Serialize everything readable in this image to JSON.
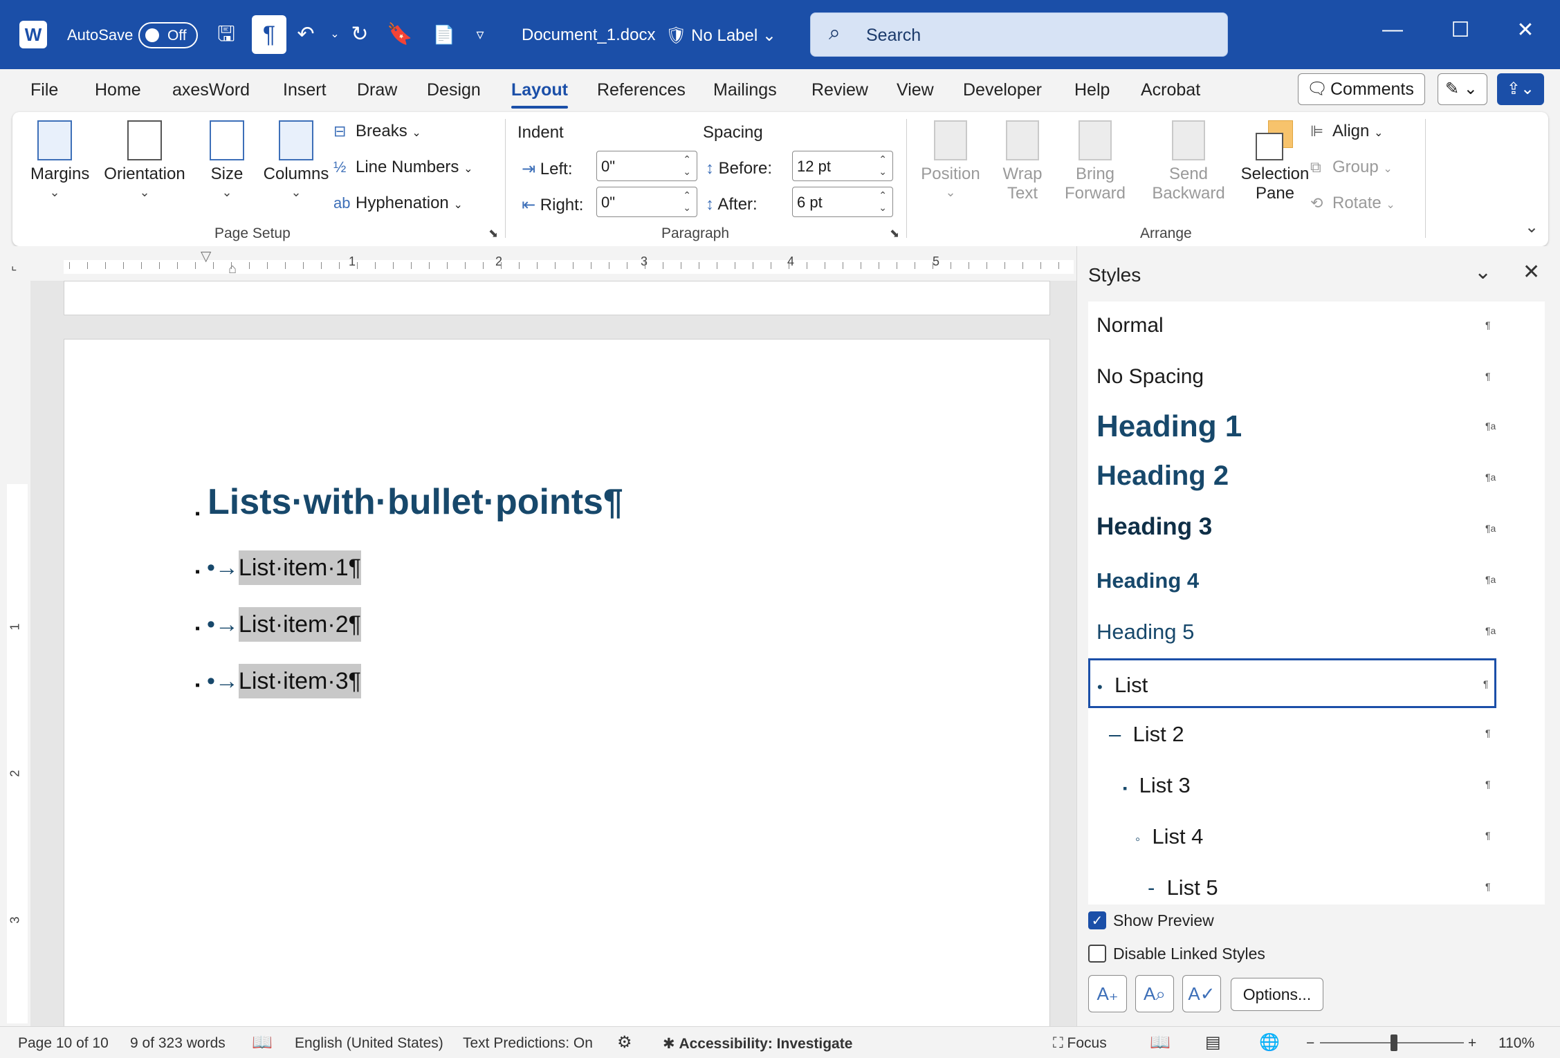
{
  "titlebar": {
    "app_logo": "W",
    "autosave_label": "AutoSave",
    "autosave_state": "Off",
    "pilcrow": "¶",
    "document_title": "Document_1.docx",
    "label_text": "No Label",
    "search_placeholder": "Search"
  },
  "tabs": [
    {
      "label": "File"
    },
    {
      "label": "Home"
    },
    {
      "label": "axesWord"
    },
    {
      "label": "Insert"
    },
    {
      "label": "Draw"
    },
    {
      "label": "Design"
    },
    {
      "label": "Layout"
    },
    {
      "label": "References"
    },
    {
      "label": "Mailings"
    },
    {
      "label": "Review"
    },
    {
      "label": "View"
    },
    {
      "label": "Developer"
    },
    {
      "label": "Help"
    },
    {
      "label": "Acrobat"
    }
  ],
  "active_tab": "Layout",
  "comments_label": "Comments",
  "ribbon": {
    "page_setup": {
      "margins": "Margins",
      "orientation": "Orientation",
      "size": "Size",
      "columns": "Columns",
      "breaks": "Breaks",
      "line_numbers": "Line Numbers",
      "hyphenation": "Hyphenation",
      "group_label": "Page Setup"
    },
    "paragraph": {
      "indent_heading": "Indent",
      "spacing_heading": "Spacing",
      "left_label": "Left:",
      "left_value": "0\"",
      "right_label": "Right:",
      "right_value": "0\"",
      "before_label": "Before:",
      "before_value": "12 pt",
      "after_label": "After:",
      "after_value": "6 pt",
      "group_label": "Paragraph"
    },
    "arrange": {
      "position_1": "Position",
      "wrap_1": "Wrap",
      "wrap_2": "Text",
      "bring_1": "Bring",
      "bring_2": "Forward",
      "send_1": "Send",
      "send_2": "Backward",
      "selection_1": "Selection",
      "selection_2": "Pane",
      "align": "Align",
      "group": "Group",
      "rotate": "Rotate",
      "group_label": "Arrange"
    }
  },
  "ruler": {
    "numbers": [
      "1",
      "2",
      "3",
      "4",
      "5"
    ],
    "vertical_numbers": [
      "1",
      "2",
      "3"
    ]
  },
  "document": {
    "heading": "Lists·with·bullet·points¶",
    "bullet_prefix": "•→",
    "items": [
      "List·item·1¶",
      "List·item·2¶",
      "List·item·3¶"
    ]
  },
  "styles_pane": {
    "title": "Styles",
    "items": [
      {
        "name": "Normal",
        "mark": "¶"
      },
      {
        "name": "No Spacing",
        "mark": "¶"
      },
      {
        "name": "Heading 1",
        "mark": "¶a"
      },
      {
        "name": "Heading 2",
        "mark": "¶a"
      },
      {
        "name": "Heading 3",
        "mark": "¶a"
      },
      {
        "name": "Heading 4",
        "mark": "¶a"
      },
      {
        "name": "Heading 5",
        "mark": "¶a"
      },
      {
        "name": "List",
        "mark": "¶",
        "bullet": "•"
      },
      {
        "name": "List 2",
        "mark": "¶",
        "bullet": "–"
      },
      {
        "name": "List 3",
        "mark": "¶",
        "bullet": "▪"
      },
      {
        "name": "List 4",
        "mark": "¶",
        "bullet": "◦"
      },
      {
        "name": "List 5",
        "mark": "¶",
        "bullet": "-"
      }
    ],
    "selected": "List",
    "show_preview": {
      "label": "Show Preview",
      "checked": true
    },
    "disable_linked": {
      "label": "Disable Linked Styles",
      "checked": false
    },
    "options_label": "Options..."
  },
  "status": {
    "page": "Page 10 of 10",
    "words": "9 of 323 words",
    "language": "English (United States)",
    "predictions": "Text Predictions: On",
    "accessibility": "Accessibility: Investigate",
    "focus": "Focus",
    "zoom": "110%",
    "zoom_minus": "−",
    "zoom_plus": "+"
  },
  "colors": {
    "brand": "#1b4fa8",
    "heading": "#17486b",
    "selection_highlight": "#c8c8c8"
  }
}
